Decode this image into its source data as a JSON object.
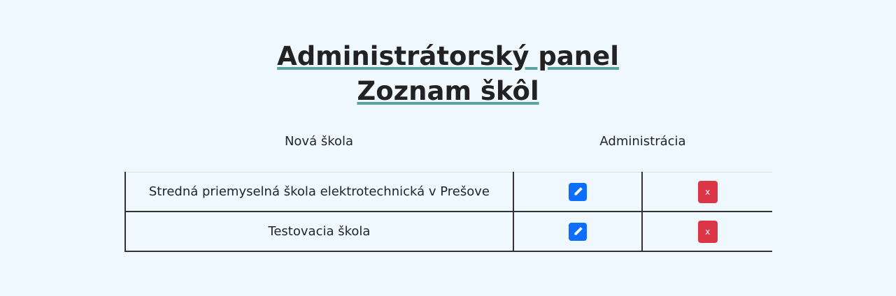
{
  "page": {
    "title_line1": "Administrátorský panel",
    "title_line2": "Zoznam škôl"
  },
  "table": {
    "header_new_school": "Nová škola",
    "header_admin": "Administrácia",
    "rows": [
      {
        "name": "Stredná priemyselná škola elektrotechnická v Prešove",
        "delete_label": "x"
      },
      {
        "name": "Testovacia škola",
        "delete_label": "x"
      }
    ]
  },
  "icons": {
    "edit": "pencil-icon",
    "delete": "close-icon"
  },
  "colors": {
    "background": "#f0f8ff",
    "title_underline": "#5fa3a0",
    "edit_button": "#0d6efd",
    "delete_button": "#dc3545"
  }
}
